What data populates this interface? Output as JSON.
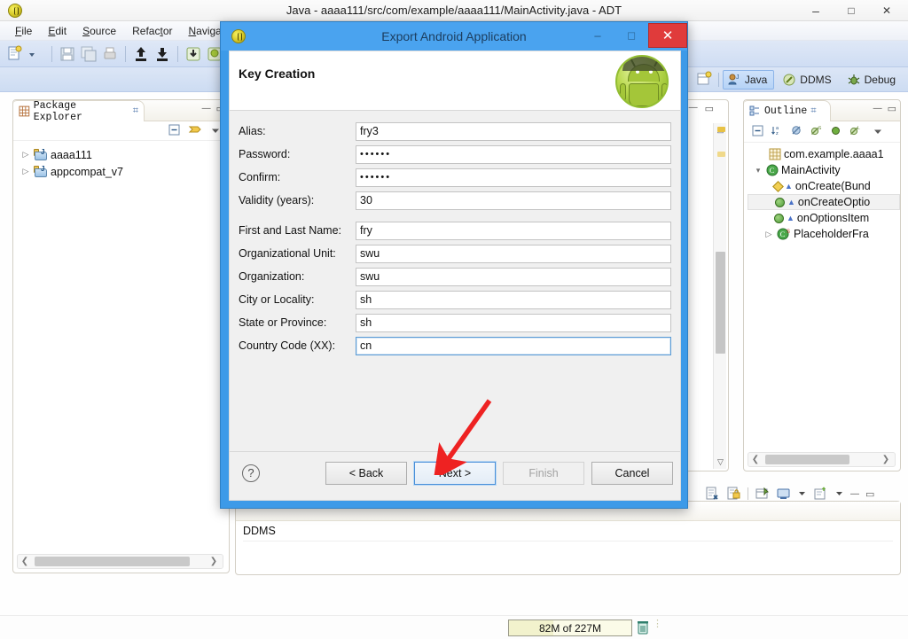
{
  "ide": {
    "title": "Java - aaaa111/src/com/example/aaaa111/MainActivity.java - ADT",
    "app_icon": "eclipse-icon",
    "window_buttons": [
      {
        "name": "minimize",
        "glyph": "–"
      },
      {
        "name": "maximize",
        "glyph": "□"
      },
      {
        "name": "close",
        "glyph": "✕"
      }
    ],
    "menu": [
      {
        "label": "File",
        "mnemonic": "F"
      },
      {
        "label": "Edit",
        "mnemonic": "E"
      },
      {
        "label": "Source",
        "mnemonic": "S"
      },
      {
        "label": "Refactor",
        "mnemonic": "t"
      },
      {
        "label": "Navigate",
        "mnemonic": "N"
      }
    ],
    "perspectives": [
      {
        "label": "Java",
        "active": true,
        "icon": "java-perspective-icon"
      },
      {
        "label": "DDMS",
        "active": false,
        "icon": "ddms-perspective-icon"
      },
      {
        "label": "Debug",
        "active": false,
        "icon": "debug-perspective-icon"
      }
    ],
    "open_perspective_icon": "open-perspective-icon"
  },
  "package_explorer": {
    "tab_label": "Package Explorer",
    "tab_icon": "package-explorer-icon",
    "close_glyph": "⌗",
    "view_buttons": [
      {
        "name": "minimize-view",
        "glyph": "—"
      },
      {
        "name": "maximize-view",
        "glyph": "▭"
      }
    ],
    "toolbar": [
      {
        "name": "collapse-all-icon"
      },
      {
        "name": "link-with-editor-icon"
      },
      {
        "name": "view-menu-icon"
      }
    ],
    "items": [
      {
        "label": "aaaa111",
        "expanded": false,
        "icon": "java-project-icon"
      },
      {
        "label": "appcompat_v7",
        "expanded": false,
        "icon": "java-project-icon"
      }
    ]
  },
  "outline": {
    "tab_label": "Outline",
    "tab_icon": "outline-icon",
    "close_glyph": "⌗",
    "view_buttons": [
      {
        "name": "minimize-view",
        "glyph": "—"
      },
      {
        "name": "maximize-view",
        "glyph": "▭"
      }
    ],
    "toolbar": [
      {
        "name": "collapse-all-icon"
      },
      {
        "name": "sort-alphabetically-icon"
      },
      {
        "name": "hide-fields-icon"
      },
      {
        "name": "hide-static-icon"
      },
      {
        "name": "hide-non-public-icon"
      },
      {
        "name": "hide-local-types-icon"
      },
      {
        "name": "view-menu-icon"
      }
    ],
    "items": [
      {
        "label": "com.example.aaaa1",
        "indent": 1,
        "icon": "package-icon",
        "selected": false,
        "twisty": ""
      },
      {
        "label": "MainActivity",
        "indent": 0,
        "icon": "class-icon",
        "selected": false,
        "twisty": "▾"
      },
      {
        "label": "onCreate(Bund",
        "indent": 2,
        "icon": "method-protected-icon",
        "selected": false,
        "twisty": ""
      },
      {
        "label": "onCreateOptio",
        "indent": 2,
        "icon": "method-public-icon",
        "selected": true,
        "twisty": ""
      },
      {
        "label": "onOptionsItem",
        "indent": 2,
        "icon": "method-public-icon",
        "selected": false,
        "twisty": ""
      },
      {
        "label": "PlaceholderFra",
        "indent": 1,
        "icon": "class-static-icon",
        "selected": false,
        "twisty": "▸"
      }
    ]
  },
  "console": {
    "label": "DDMS",
    "toolbar": [
      {
        "name": "remove-launch-icon"
      },
      {
        "name": "lock-console-icon"
      },
      {
        "name": "pin-console-icon"
      },
      {
        "name": "display-selected-console-icon"
      },
      {
        "name": "open-console-icon"
      },
      {
        "name": "minimize-view",
        "glyph": "—"
      },
      {
        "name": "maximize-view",
        "glyph": "▭"
      }
    ]
  },
  "status_bar": {
    "heap_label": "82M of 227M",
    "heap_percent": 36,
    "trash_icon": "run-gc-icon"
  },
  "dialog": {
    "window_title": "Export Android Application",
    "app_icon": "eclipse-icon",
    "window_buttons": [
      {
        "name": "minimize",
        "glyph": "–"
      },
      {
        "name": "maximize",
        "glyph": "□"
      },
      {
        "name": "close",
        "glyph": "✕"
      }
    ],
    "page_title": "Key Creation",
    "banner_icon": "android-robot-icon",
    "fields_group_1": [
      {
        "label": "Alias:",
        "value": "fry3",
        "type": "text",
        "focused": false
      },
      {
        "label": "Password:",
        "value": "••••••",
        "type": "password",
        "focused": false
      },
      {
        "label": "Confirm:",
        "value": "••••••",
        "type": "password",
        "focused": false
      },
      {
        "label": "Validity (years):",
        "value": "30",
        "type": "text",
        "focused": false
      }
    ],
    "fields_group_2": [
      {
        "label": "First and Last Name:",
        "value": "fry",
        "type": "text",
        "focused": false
      },
      {
        "label": "Organizational Unit:",
        "value": "swu",
        "type": "text",
        "focused": false
      },
      {
        "label": "Organization:",
        "value": "swu",
        "type": "text",
        "focused": false
      },
      {
        "label": "City or Locality:",
        "value": "sh",
        "type": "text",
        "focused": false
      },
      {
        "label": "State or Province:",
        "value": "sh",
        "type": "text",
        "focused": false
      },
      {
        "label": "Country Code (XX):",
        "value": "cn",
        "type": "text",
        "focused": true
      }
    ],
    "help_glyph": "?",
    "buttons": [
      {
        "label": "< Back",
        "name": "back-button",
        "state": "enabled"
      },
      {
        "label": "Next >",
        "name": "next-button",
        "state": "focused"
      },
      {
        "label": "Finish",
        "name": "finish-button",
        "state": "disabled"
      },
      {
        "label": "Cancel",
        "name": "cancel-button",
        "state": "enabled"
      }
    ]
  },
  "annotation": {
    "name": "red-arrow-pointing-to-next-button",
    "color": "#ee2222"
  }
}
